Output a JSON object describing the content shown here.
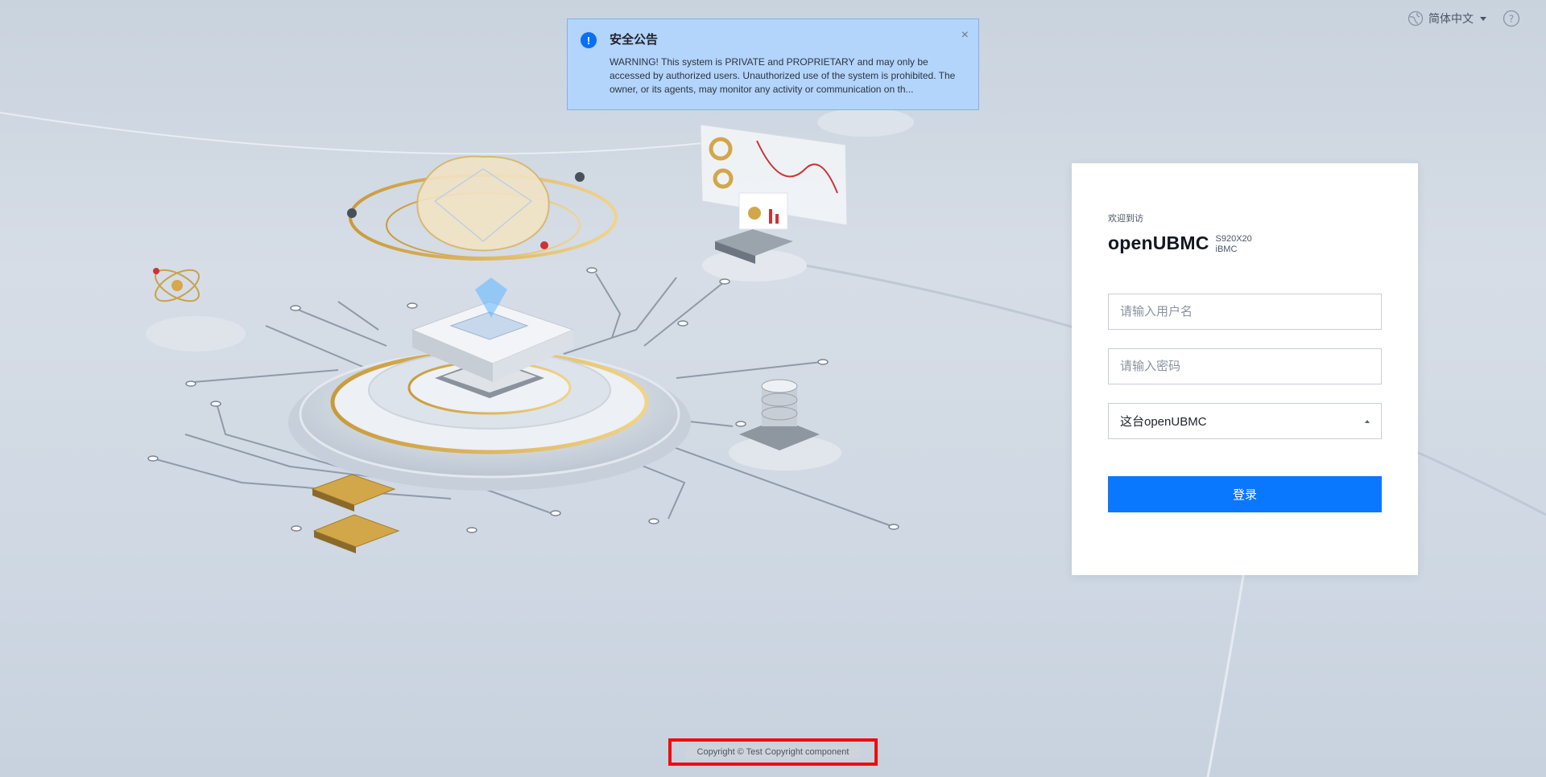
{
  "topbar": {
    "language": "简体中文"
  },
  "notice": {
    "title": "安全公告",
    "body": "WARNING! This system is PRIVATE and PROPRIETARY and may only be accessed by authorized users. Unauthorized use of the system is prohibited. The owner, or its agents, may monitor any activity or communication on th..."
  },
  "login": {
    "welcome": "欢迎到访",
    "brand": "openUBMC",
    "model": "S920X20",
    "product": "iBMC",
    "username_placeholder": "请输入用户名",
    "password_placeholder": "请输入密码",
    "domain_value": "这台openUBMC",
    "submit_label": "登录"
  },
  "footer": {
    "copyright": "Copyright © Test Copyright component"
  },
  "colors": {
    "primary": "#0a77ff",
    "notice_bg": "#b3d4fb",
    "highlight": "#f00d0d"
  }
}
